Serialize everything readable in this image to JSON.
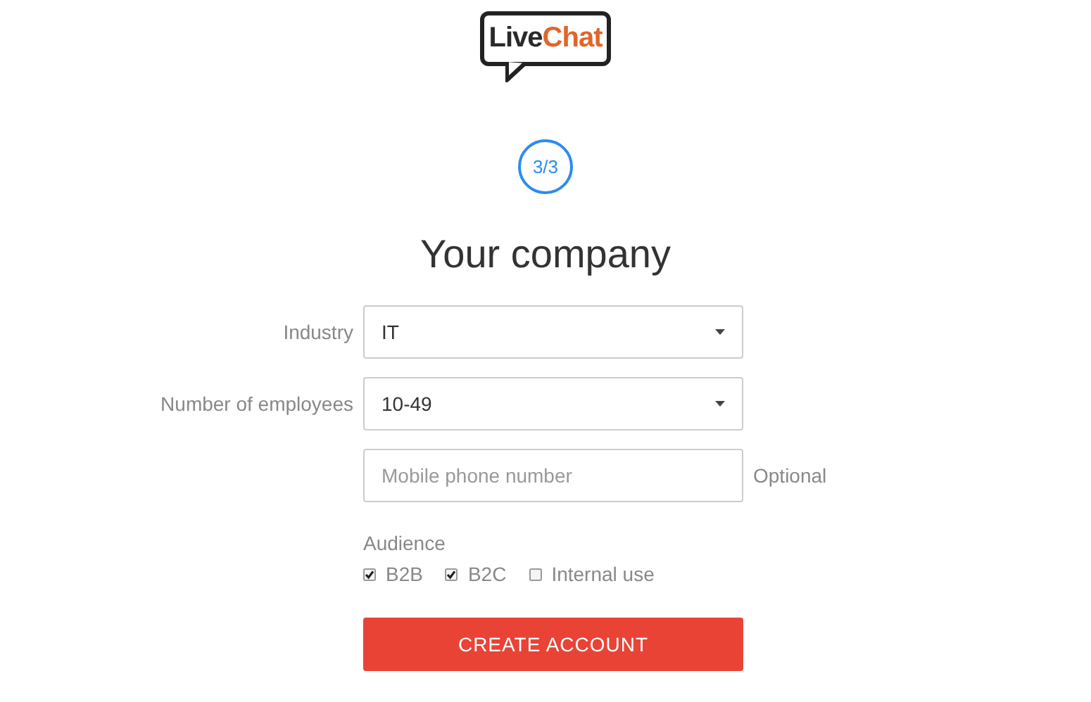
{
  "logo": {
    "dark_part": "Live",
    "accent_part": "Chat"
  },
  "step": {
    "label": "3/3"
  },
  "title": "Your company",
  "fields": [
    {
      "kind": "select",
      "label": "Industry",
      "value": "IT"
    },
    {
      "kind": "select",
      "label": "Number of employees",
      "value": "10-49"
    },
    {
      "kind": "input",
      "placeholder": "Mobile phone number",
      "note": "Optional"
    }
  ],
  "audience": {
    "label": "Audience",
    "options": [
      {
        "label": "B2B",
        "checked": true
      },
      {
        "label": "B2C",
        "checked": true
      },
      {
        "label": "Internal use",
        "checked": false
      }
    ]
  },
  "submit": {
    "label": "CREATE ACCOUNT"
  }
}
